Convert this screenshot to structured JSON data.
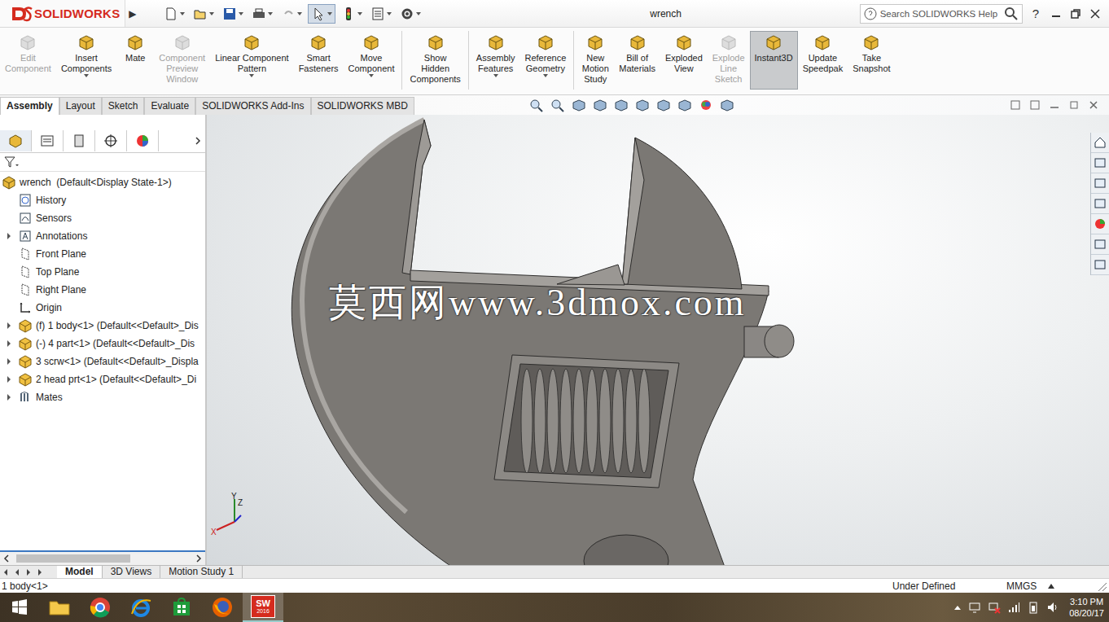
{
  "titlebar": {
    "logo": "SOLIDWORKS",
    "expand": "▶",
    "title": "wrench",
    "search_placeholder": "Search SOLIDWORKS Help",
    "help": "?"
  },
  "ribbon": [
    {
      "lines": [
        "Edit",
        "Component"
      ],
      "disabled": true,
      "selected": false,
      "dropdown": false,
      "group_end": false
    },
    {
      "lines": [
        "Insert",
        "Components"
      ],
      "disabled": false,
      "selected": false,
      "dropdown": true,
      "group_end": false
    },
    {
      "lines": [
        "Mate"
      ],
      "disabled": false,
      "selected": false,
      "dropdown": false,
      "group_end": false
    },
    {
      "lines": [
        "Component",
        "Preview",
        "Window"
      ],
      "disabled": true,
      "selected": false,
      "dropdown": false,
      "group_end": false
    },
    {
      "lines": [
        "Linear Component",
        "Pattern"
      ],
      "disabled": false,
      "selected": false,
      "dropdown": true,
      "group_end": false
    },
    {
      "lines": [
        "Smart",
        "Fasteners"
      ],
      "disabled": false,
      "selected": false,
      "dropdown": false,
      "group_end": false
    },
    {
      "lines": [
        "Move",
        "Component"
      ],
      "disabled": false,
      "selected": false,
      "dropdown": true,
      "group_end": true
    },
    {
      "lines": [
        "Show",
        "Hidden",
        "Components"
      ],
      "disabled": false,
      "selected": false,
      "dropdown": false,
      "group_end": true
    },
    {
      "lines": [
        "Assembly",
        "Features"
      ],
      "disabled": false,
      "selected": false,
      "dropdown": true,
      "group_end": false
    },
    {
      "lines": [
        "Reference",
        "Geometry"
      ],
      "disabled": false,
      "selected": false,
      "dropdown": true,
      "group_end": true
    },
    {
      "lines": [
        "New",
        "Motion",
        "Study"
      ],
      "disabled": false,
      "selected": false,
      "dropdown": false,
      "group_end": false
    },
    {
      "lines": [
        "Bill of",
        "Materials"
      ],
      "disabled": false,
      "selected": false,
      "dropdown": false,
      "group_end": false
    },
    {
      "lines": [
        "Exploded",
        "View"
      ],
      "disabled": false,
      "selected": false,
      "dropdown": false,
      "group_end": false
    },
    {
      "lines": [
        "Explode",
        "Line",
        "Sketch"
      ],
      "disabled": true,
      "selected": false,
      "dropdown": false,
      "group_end": false
    },
    {
      "lines": [
        "Instant3D"
      ],
      "disabled": false,
      "selected": true,
      "dropdown": false,
      "group_end": false
    },
    {
      "lines": [
        "Update",
        "Speedpak"
      ],
      "disabled": false,
      "selected": false,
      "dropdown": false,
      "group_end": false
    },
    {
      "lines": [
        "Take",
        "Snapshot"
      ],
      "disabled": false,
      "selected": false,
      "dropdown": false,
      "group_end": false
    }
  ],
  "command_tabs": [
    {
      "label": "Assembly",
      "selected": true
    },
    {
      "label": "Layout",
      "selected": false
    },
    {
      "label": "Sketch",
      "selected": false
    },
    {
      "label": "Evaluate",
      "selected": false
    },
    {
      "label": "SOLIDWORKS Add-Ins",
      "selected": false
    },
    {
      "label": "SOLIDWORKS MBD",
      "selected": false
    }
  ],
  "tree": {
    "root": "wrench  (Default<Display State-1>)",
    "items": [
      {
        "label": "History",
        "kind": "history",
        "expandable": false
      },
      {
        "label": "Sensors",
        "kind": "sensor",
        "expandable": false
      },
      {
        "label": "Annotations",
        "kind": "annotation",
        "expandable": true
      },
      {
        "label": "Front Plane",
        "kind": "plane",
        "expandable": false
      },
      {
        "label": "Top Plane",
        "kind": "plane",
        "expandable": false
      },
      {
        "label": "Right Plane",
        "kind": "plane",
        "expandable": false
      },
      {
        "label": "Origin",
        "kind": "origin",
        "expandable": false
      },
      {
        "label": "(f) 1 body<1> (Default<<Default>_Dis",
        "kind": "part",
        "expandable": true
      },
      {
        "label": "(-) 4 part<1> (Default<<Default>_Dis",
        "kind": "part",
        "expandable": true
      },
      {
        "label": "3 scrw<1> (Default<<Default>_Displa",
        "kind": "part",
        "expandable": true
      },
      {
        "label": "2 head prt<1> (Default<<Default>_Di",
        "kind": "part",
        "expandable": true
      },
      {
        "label": "Mates",
        "kind": "mates",
        "expandable": true
      }
    ]
  },
  "graphics": {
    "watermark": "莫西网www.3dmox.com",
    "axes": [
      "Y",
      "Z",
      "X"
    ]
  },
  "bottom_tabs": [
    {
      "label": "Model",
      "selected": true
    },
    {
      "label": "3D Views",
      "selected": false
    },
    {
      "label": "Motion Study 1",
      "selected": false
    }
  ],
  "status": {
    "left": "1 body<1>",
    "state": "Under Defined",
    "units": "MMGS"
  },
  "taskbar": {
    "sw_label": "SW",
    "sw_version": "2016",
    "time": "3:10 PM",
    "date": "08/20/17"
  }
}
